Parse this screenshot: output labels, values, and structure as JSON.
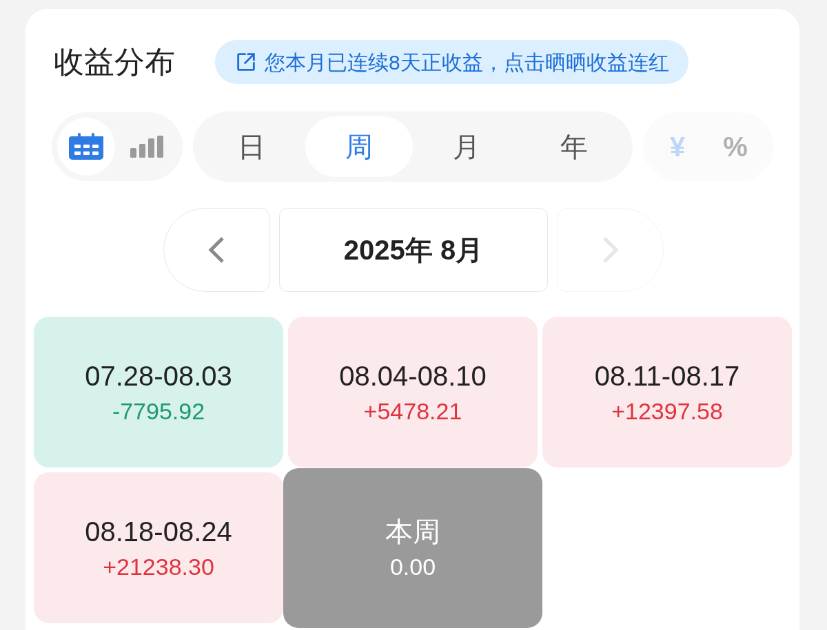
{
  "title": "收益分布",
  "banner": {
    "text": "您本月已连续8天正收益，点击晒晒收益连红"
  },
  "view_toggle": [
    {
      "kind": "calendar",
      "selected": true
    },
    {
      "kind": "bars",
      "selected": false
    }
  ],
  "period_tabs": [
    {
      "label": "日",
      "selected": false
    },
    {
      "label": "周",
      "selected": true
    },
    {
      "label": "月",
      "selected": false
    },
    {
      "label": "年",
      "selected": false
    }
  ],
  "unit_toggle": {
    "disabled": true,
    "options": [
      {
        "label": "¥",
        "selected": true
      },
      {
        "label": "%",
        "selected": false
      }
    ]
  },
  "month_nav": {
    "label": "2025年 8月",
    "prev_disabled": false,
    "next_disabled": true
  },
  "weeks": [
    {
      "range": "07.28-08.03",
      "value": "-7795.92",
      "kind": "loss"
    },
    {
      "range": "08.04-08.10",
      "value": "+5478.21",
      "kind": "gain"
    },
    {
      "range": "08.11-08.17",
      "value": "+12397.58",
      "kind": "gain"
    },
    {
      "range": "08.18-08.24",
      "value": "+21238.30",
      "kind": "gain"
    },
    {
      "range": "本周",
      "value": "0.00",
      "kind": "current"
    }
  ]
}
